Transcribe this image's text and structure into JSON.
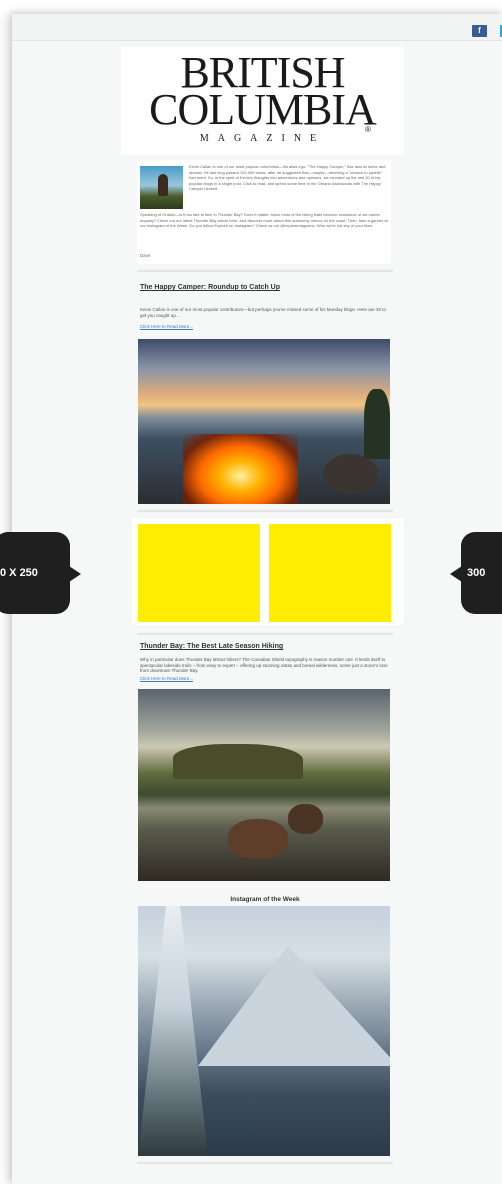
{
  "social": {
    "facebook": "f",
    "twitter": "t"
  },
  "logo": {
    "line1": "BRITISH",
    "line2": "COLUMBIA",
    "line3": "MAGAZINE",
    "reg": "®"
  },
  "intro": {
    "text_top": "Kevin Callan is one of our most popular columnists—his alias ego, \"The Happy Camper,\" has fans at home and abroad. He last blog passed 100,000 views, after he suggested that—maybe—returning a \"chance to paddle\" had merit. So, in the spirit of Kevin's thoughts into adventures and opinions, we rounded up the last 20 of his popular blogs in a single post. Click to read, and spend some time in the Ontario backwoods with The Happy Camper himself.",
    "text_bottom": "Speaking of Ontario—is it too late to hike in Thunder Bay? Does it matter, since most of the hiking trails become snowshoe or ski routes anyway? Check out our latest Thunder Bay article here, and discover more about this outdoorsy mecca on the coast. Then, take a gander at our Instagram of the Week. Do you follow Explore on Instagram? Check us out @exploremagazine. Who we're not shy of your likes.",
    "signoff": "Dave"
  },
  "article1": {
    "title": "The Happy Camper: Roundup to Catch Up",
    "body": "Kevin Callan is one of our most popular contributors—but perhaps you've missed some of his Monday blogs. Here are 20 to get you caught up…",
    "link": "Click Here to Read More..."
  },
  "ads": {
    "left_label": "0 X 250",
    "right_label": "300"
  },
  "article2": {
    "title": "Thunder Bay: The Best Late Season Hiking",
    "body": "Why in particular does Thunder Bay attract hikers? The Canadian Shield topography is reason number one. It lends itself to spectacular lakeside trails – from easy to expert – offering up stunning vistas and boreal wilderness, some just a stone's toss from downtown Thunder Bay.",
    "link": "Click Here to Read More..."
  },
  "instagram": {
    "title": "Instagram of the Week"
  }
}
